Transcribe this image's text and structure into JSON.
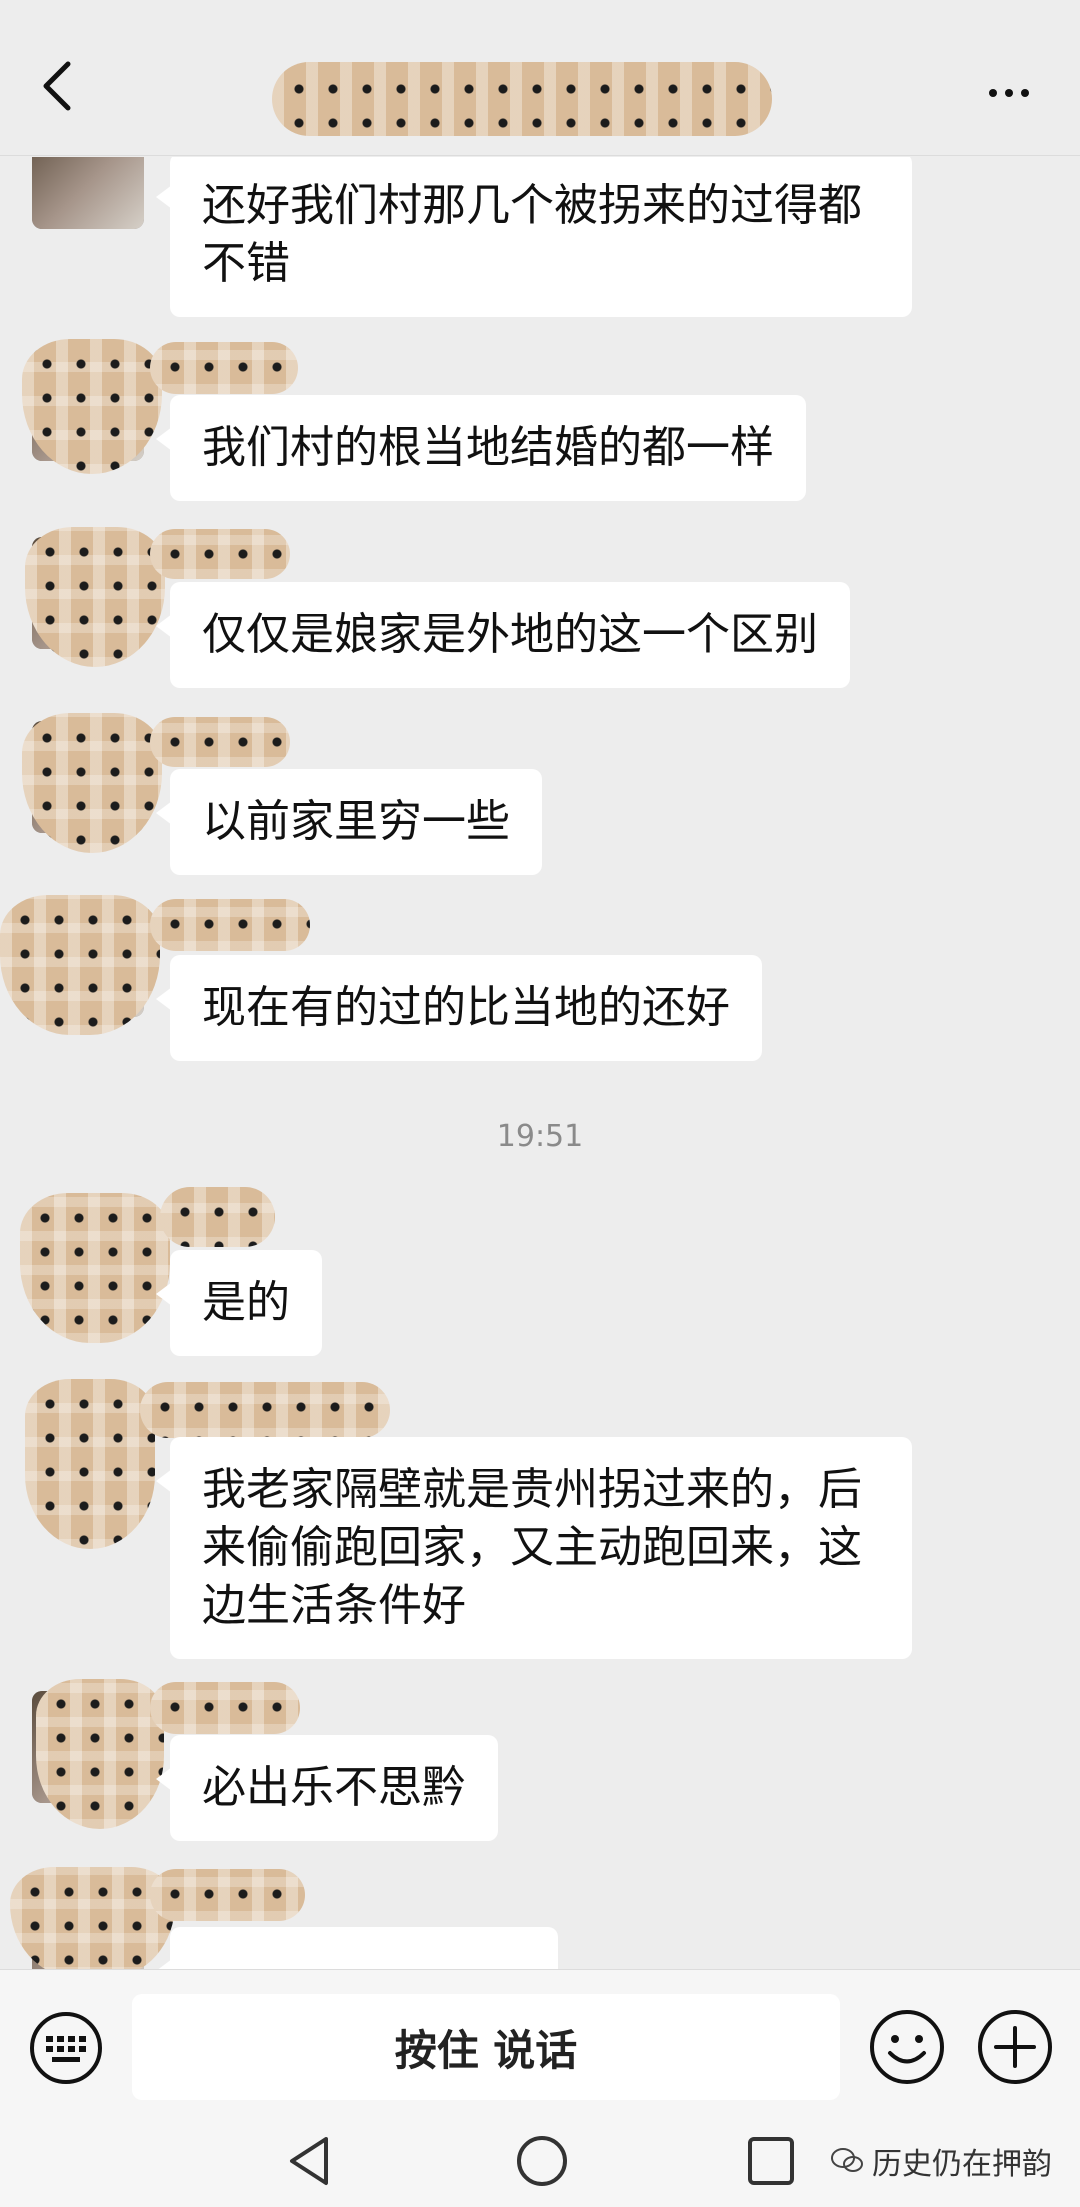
{
  "header": {
    "back_icon": "chevron-left-icon",
    "more_icon": "more-dots-icon"
  },
  "messages": [
    {
      "text": "还好我们村那几个被拐来的过得都\n不错"
    },
    {
      "text": "我们村的根当地结婚的都一样"
    },
    {
      "text": "仅仅是娘家是外地的这一个区别"
    },
    {
      "text": "以前家里穷一些"
    },
    {
      "text": "现在有的过的比当地的还好"
    },
    {
      "text": "是的"
    },
    {
      "text": "我老家隔壁就是贵州拐过来的，后\n来偷偷跑回家，又主动跑回来，这\n边生活条件好"
    },
    {
      "text": "必出乐不思黔"
    }
  ],
  "timestamp": "19:51",
  "input_bar": {
    "keyboard_icon": "keyboard-icon",
    "voice_label": "按住 说话",
    "emoji_icon": "emoji-icon",
    "plus_icon": "plus-icon"
  },
  "nav": {
    "back_icon": "triangle-back-icon",
    "home_icon": "circle-home-icon",
    "recent_icon": "square-recent-icon"
  },
  "watermark": {
    "text": "历史仍在押韵"
  },
  "colors": {
    "background": "#ededed",
    "bubble": "#ffffff",
    "timestamp": "#8a8a8a"
  }
}
